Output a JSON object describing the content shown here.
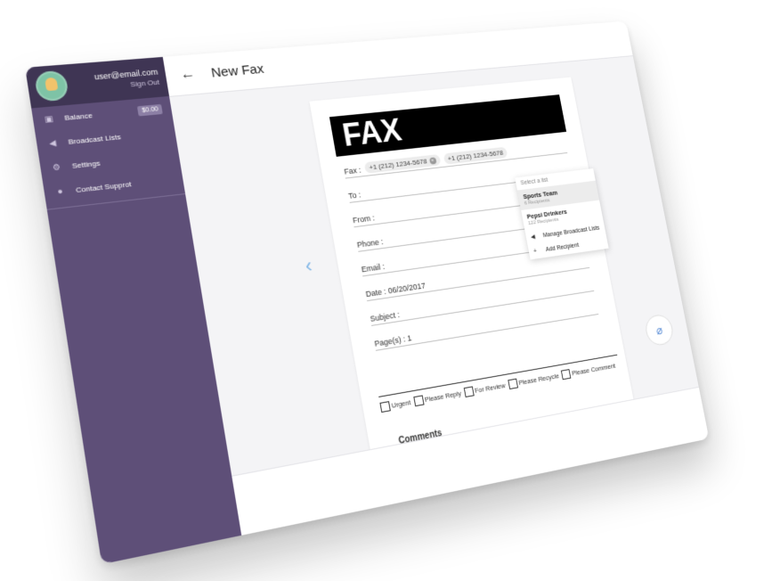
{
  "user": {
    "email": "user@email.com",
    "sign_out": "Sign Out"
  },
  "sidebar": {
    "items": [
      {
        "label": "Balance",
        "icon": "wallet-icon",
        "badge": "$0.00"
      },
      {
        "label": "Broadcast Lists",
        "icon": "megaphone-icon"
      },
      {
        "label": "Settings",
        "icon": "gear-icon"
      },
      {
        "label": "Contact Supprot",
        "icon": "support-icon"
      }
    ]
  },
  "header": {
    "title": "New Fax",
    "back_icon": "arrow-left-icon"
  },
  "fax": {
    "banner": "FAX",
    "fax_label": "Fax :",
    "chips": [
      "+1 (212) 1234-5678",
      "+1 (212) 1234-5678"
    ],
    "to_label": "To :",
    "from_label": "From :",
    "phone_label": "Phone :",
    "email_label": "Email :",
    "date_label": "Date : 06/20/2017",
    "subject_label": "Subject :",
    "pages_label": "Page(s) : 1",
    "checkboxes": [
      "Urgent",
      "Please Reply",
      "For Review",
      "Please Recycle",
      "Please Comment"
    ],
    "comments_label": "Comments"
  },
  "dropdown": {
    "header": "Select a list",
    "lists": [
      {
        "name": "Sports Team",
        "sub": "6 Recipients"
      },
      {
        "name": "Pepsi Drinkers",
        "sub": "122 Recipients"
      }
    ],
    "manage": "Manage Broadcast Lists",
    "add": "Add Recipient"
  },
  "nav": {
    "prev_icon": "chevron-left-icon",
    "next_icon": "chevron-right-icon"
  },
  "colors": {
    "sidebar": "#5e4f78",
    "sidebar_top": "#3f3554",
    "accent": "#2a95d4"
  }
}
